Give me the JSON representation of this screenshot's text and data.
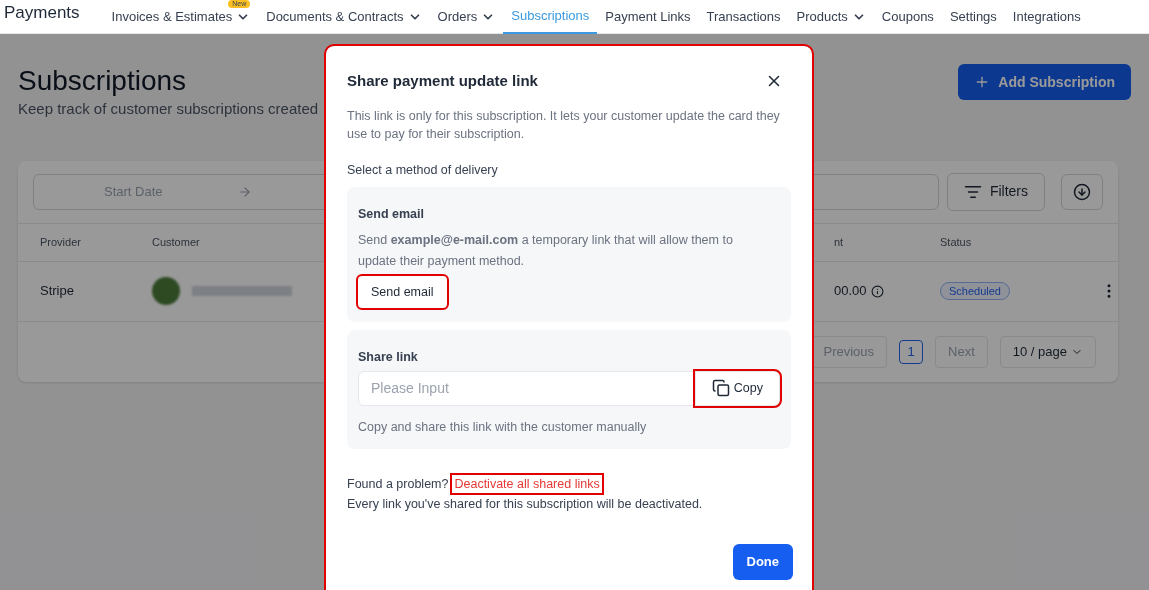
{
  "nav": {
    "brand": "Payments",
    "items": [
      {
        "label": "Invoices & Estimates",
        "badge": "New",
        "dropdown": true,
        "selected": false
      },
      {
        "label": "Documents & Contracts",
        "dropdown": true,
        "selected": false
      },
      {
        "label": "Orders",
        "dropdown": true,
        "selected": false
      },
      {
        "label": "Subscriptions",
        "dropdown": false,
        "selected": true
      },
      {
        "label": "Payment Links",
        "dropdown": false,
        "selected": false
      },
      {
        "label": "Transactions",
        "dropdown": false,
        "selected": false
      },
      {
        "label": "Products",
        "dropdown": true,
        "selected": false
      },
      {
        "label": "Coupons",
        "dropdown": false,
        "selected": false
      },
      {
        "label": "Settings",
        "dropdown": false,
        "selected": false
      },
      {
        "label": "Integrations",
        "dropdown": false,
        "selected": false
      }
    ]
  },
  "page": {
    "title": "Subscriptions",
    "subtitle": "Keep track of customer subscriptions created",
    "add_button": "Add Subscription"
  },
  "filters": {
    "start_date_placeholder": "Start Date",
    "filters_button": "Filters"
  },
  "table": {
    "columns": [
      "Provider",
      "Customer",
      "nt",
      "Status"
    ],
    "rows": [
      {
        "provider": "Stripe",
        "amount": "00.00",
        "status": "Scheduled"
      }
    ]
  },
  "pagination": {
    "previous": "Previous",
    "pages": [
      {
        "label": "1",
        "selected": true
      }
    ],
    "next": "Next",
    "page_size": "10 / page"
  },
  "modal": {
    "title": "Share payment update link",
    "description": "This link is only for this subscription. It lets your customer update the card they use to pay for their subscription.",
    "method_label": "Select a method of delivery",
    "send_email": {
      "title": "Send email",
      "text": "Send **example@e-mail.com** a temporary link that will allow them to update their payment method.",
      "button": "Send email",
      "highlighted": true
    },
    "share_link": {
      "title": "Share link",
      "placeholder": "Please Input",
      "copy_button": "Copy",
      "copy_highlighted": true,
      "hint": "Copy and share this link with the customer manually"
    },
    "problem": {
      "text": "Found a problem?",
      "link": "Deactivate all shared links",
      "link_highlighted": true,
      "note": "Every link you've shared for this subscription will be deactivated."
    },
    "done_button": "Done",
    "highlighted": true
  }
}
